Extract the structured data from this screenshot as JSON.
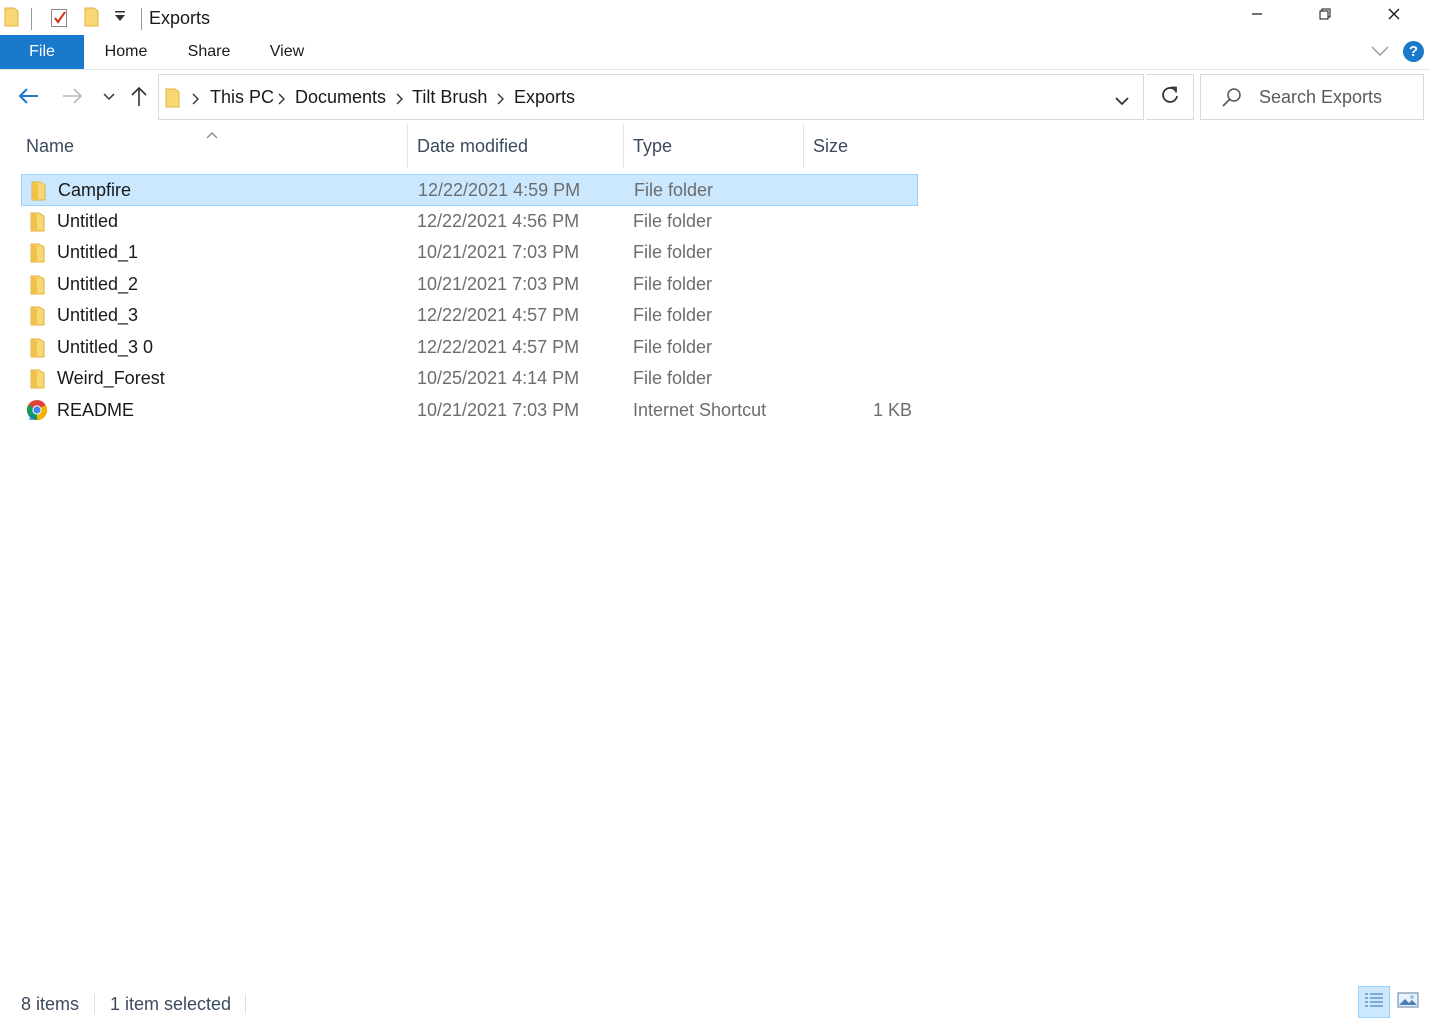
{
  "window": {
    "title": "Exports",
    "controls": {
      "minimize": "minimize-icon",
      "restore": "restore-icon",
      "close": "close-icon"
    }
  },
  "quick_access": [
    "folder-icon",
    "properties-icon",
    "new-folder-icon",
    "customize-dropdown-icon"
  ],
  "ribbon": {
    "tabs": [
      {
        "label": "File",
        "active": true
      },
      {
        "label": "Home"
      },
      {
        "label": "Share"
      },
      {
        "label": "View"
      }
    ],
    "help_label": "?",
    "accent_color": "#1979ca"
  },
  "address_bar": {
    "breadcrumbs": [
      "This PC",
      "Documents",
      "Tilt Brush",
      "Exports"
    ]
  },
  "search": {
    "placeholder": "Search Exports"
  },
  "columns": {
    "name": "Name",
    "date": "Date modified",
    "type": "Type",
    "size": "Size",
    "sorted_by": "Name"
  },
  "files": [
    {
      "name": "Campfire",
      "date": "12/22/2021 4:59 PM",
      "type": "File folder",
      "size": "",
      "icon": "folder-icon",
      "selected": true
    },
    {
      "name": "Untitled",
      "date": "12/22/2021 4:56 PM",
      "type": "File folder",
      "size": "",
      "icon": "folder-icon"
    },
    {
      "name": "Untitled_1",
      "date": "10/21/2021 7:03 PM",
      "type": "File folder",
      "size": "",
      "icon": "folder-icon"
    },
    {
      "name": "Untitled_2",
      "date": "10/21/2021 7:03 PM",
      "type": "File folder",
      "size": "",
      "icon": "folder-icon"
    },
    {
      "name": "Untitled_3",
      "date": "12/22/2021 4:57 PM",
      "type": "File folder",
      "size": "",
      "icon": "folder-icon"
    },
    {
      "name": "Untitled_3 0",
      "date": "12/22/2021 4:57 PM",
      "type": "File folder",
      "size": "",
      "icon": "folder-icon"
    },
    {
      "name": "Weird_Forest",
      "date": "10/25/2021 4:14 PM",
      "type": "File folder",
      "size": "",
      "icon": "folder-icon"
    },
    {
      "name": "README",
      "date": "10/21/2021 7:03 PM",
      "type": "Internet Shortcut",
      "size": "1 KB",
      "icon": "chrome-shortcut-icon"
    }
  ],
  "status": {
    "item_count": "8 items",
    "selection": "1 item selected"
  },
  "colors": {
    "selection_bg": "#cce8ff",
    "selection_border": "#99d1ff",
    "folder": "#f8d775"
  }
}
